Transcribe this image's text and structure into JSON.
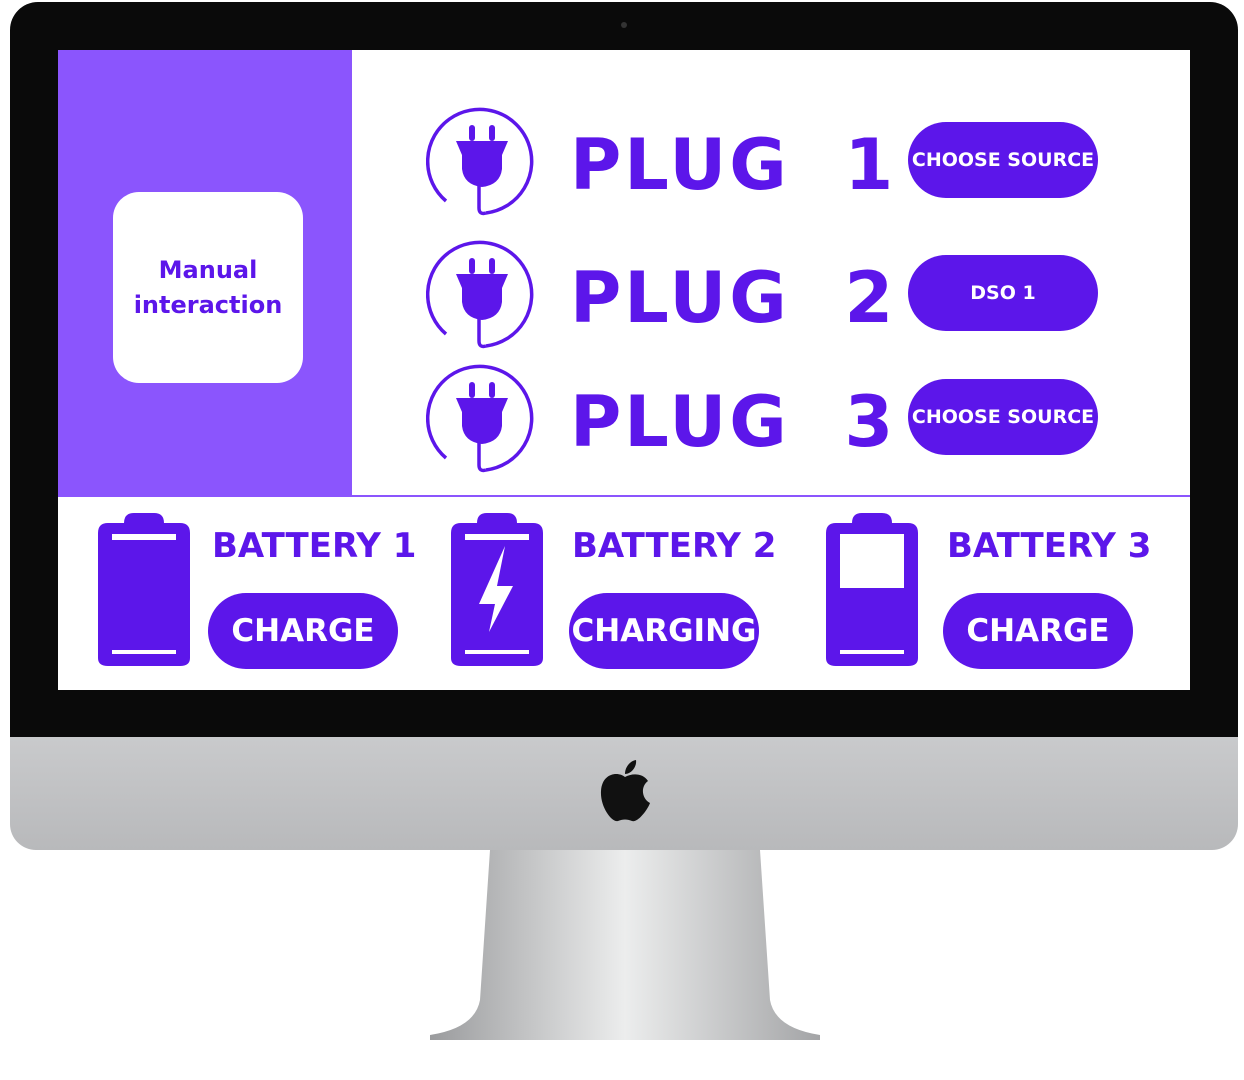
{
  "accent": "#5c16ea",
  "sidebar_color": "#8b55fd",
  "sidebar": {
    "card_line1": "Manual",
    "card_line2": "interaction"
  },
  "plugs": [
    {
      "label": "PLUG  1",
      "button": "CHOOSE SOURCE",
      "icon": "plug-icon"
    },
    {
      "label": "PLUG  2",
      "button": "DSO 1",
      "icon": "plug-icon"
    },
    {
      "label": "PLUG  3",
      "button": "CHOOSE SOURCE",
      "icon": "plug-icon"
    }
  ],
  "batteries": [
    {
      "label": "BATTERY 1",
      "button": "CHARGE",
      "icon": "battery-full-icon",
      "level": 1.0
    },
    {
      "label": "BATTERY 2",
      "button": "CHARGING",
      "icon": "battery-charging-icon"
    },
    {
      "label": "BATTERY 3",
      "button": "CHARGE",
      "icon": "battery-low-icon",
      "level": 0.4
    }
  ]
}
